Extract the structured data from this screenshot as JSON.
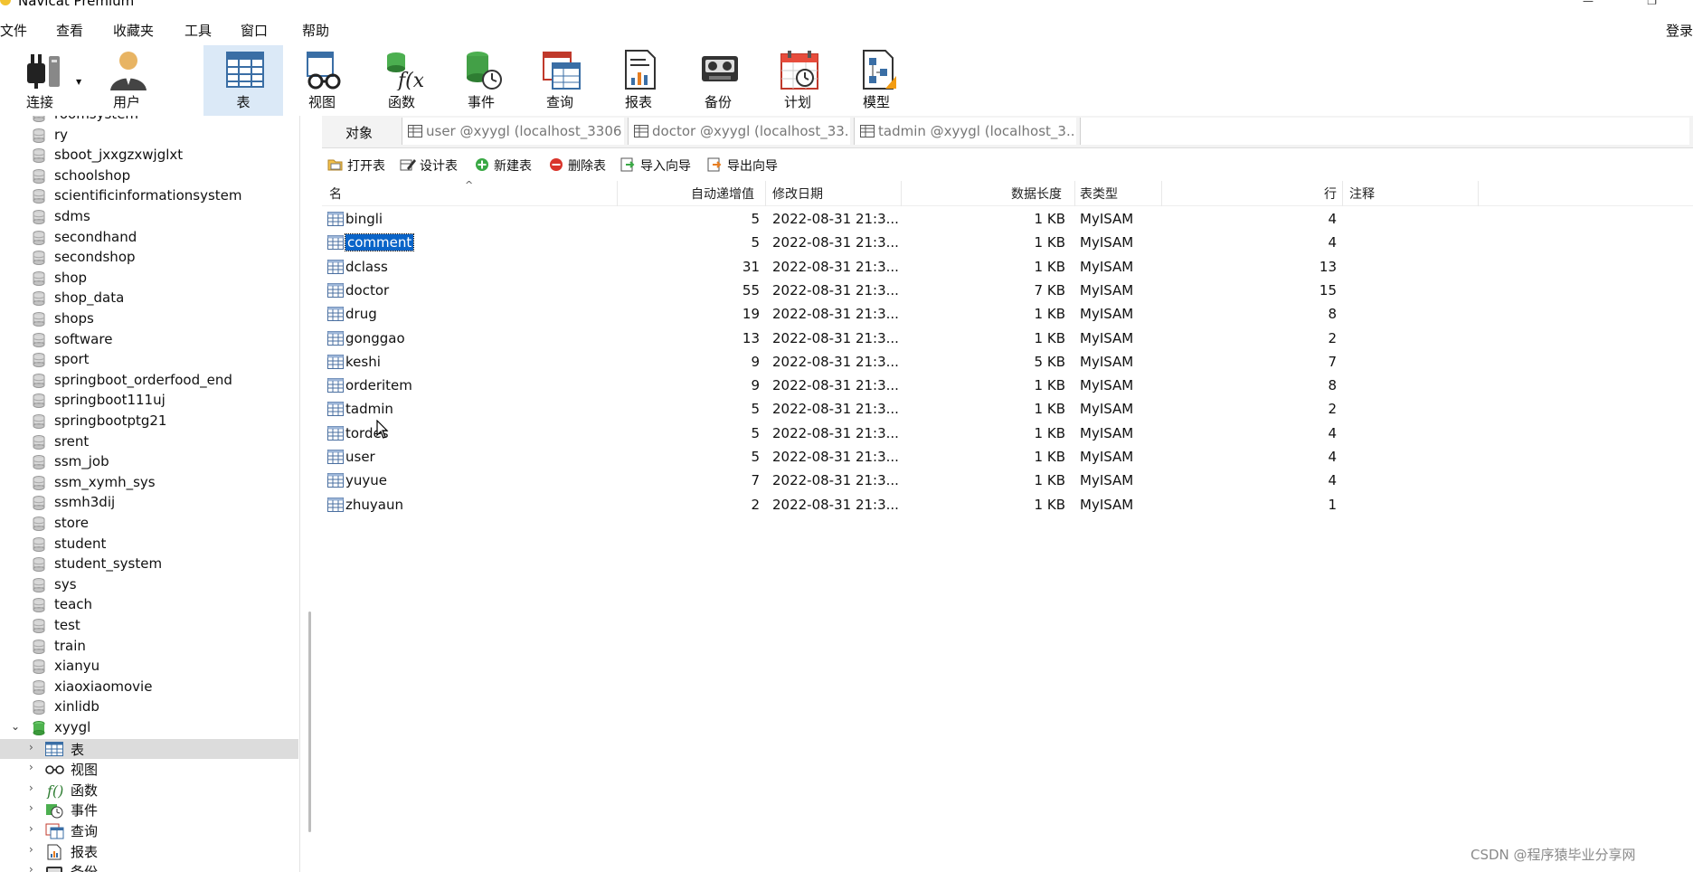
{
  "window": {
    "title": "Navicat Premium"
  },
  "menu": {
    "items": [
      "文件",
      "查看",
      "收藏夹",
      "工具",
      "窗口",
      "帮助"
    ],
    "login": "登录"
  },
  "toolbar": {
    "items": [
      {
        "label": "连接",
        "icon": "plug-icon"
      },
      {
        "label": "用户",
        "icon": "user-icon"
      },
      {
        "label": "表",
        "icon": "table-icon"
      },
      {
        "label": "视图",
        "icon": "view-icon"
      },
      {
        "label": "函数",
        "icon": "function-icon"
      },
      {
        "label": "事件",
        "icon": "event-icon"
      },
      {
        "label": "查询",
        "icon": "query-icon"
      },
      {
        "label": "报表",
        "icon": "report-icon"
      },
      {
        "label": "备份",
        "icon": "backup-icon"
      },
      {
        "label": "计划",
        "icon": "schedule-icon"
      },
      {
        "label": "模型",
        "icon": "model-icon"
      }
    ]
  },
  "sidebar": {
    "databases": [
      "roomsystem",
      "ry",
      "sboot_jxxgzxwjglxt",
      "schoolshop",
      "scientificinformationsystem",
      "sdms",
      "secondhand",
      "secondshop",
      "shop",
      "shop_data",
      "shops",
      "software",
      "sport",
      "springboot_orderfood_end",
      "springboot111uj",
      "springbootptg21",
      "srent",
      "ssm_job",
      "ssm_xymh_sys",
      "ssmh3dij",
      "store",
      "student",
      "student_system",
      "sys",
      "teach",
      "test",
      "train",
      "xianyu",
      "xiaoxiaomovie",
      "xinlidb"
    ],
    "open_db": "xyygl",
    "children": [
      {
        "label": "表",
        "icon": "table-icon"
      },
      {
        "label": "视图",
        "icon": "view-icon"
      },
      {
        "label": "函数",
        "icon": "function-icon"
      },
      {
        "label": "事件",
        "icon": "event-icon"
      },
      {
        "label": "查询",
        "icon": "query-icon"
      },
      {
        "label": "报表",
        "icon": "report-icon"
      },
      {
        "label": "备份",
        "icon": "backup-icon"
      }
    ]
  },
  "object_tabs": {
    "label": "对象",
    "tabs": [
      "user @xyygl (localhost_3306...",
      "doctor @xyygl (localhost_33...",
      "tadmin @xyygl (localhost_3..."
    ]
  },
  "actions": [
    "打开表",
    "设计表",
    "新建表",
    "删除表",
    "导入向导",
    "导出向导"
  ],
  "table": {
    "columns": [
      "名",
      "自动递增值",
      "修改日期",
      "数据长度",
      "表类型",
      "行",
      "注释"
    ],
    "selected": "comment",
    "rows": [
      {
        "name": "bingli",
        "auto_inc": "5",
        "modified": "2022-08-31 21:3...",
        "data_len": "1 KB",
        "engine": "MyISAM",
        "rows": "4"
      },
      {
        "name": "comment",
        "auto_inc": "5",
        "modified": "2022-08-31 21:3...",
        "data_len": "1 KB",
        "engine": "MyISAM",
        "rows": "4"
      },
      {
        "name": "dclass",
        "auto_inc": "31",
        "modified": "2022-08-31 21:3...",
        "data_len": "1 KB",
        "engine": "MyISAM",
        "rows": "13"
      },
      {
        "name": "doctor",
        "auto_inc": "55",
        "modified": "2022-08-31 21:3...",
        "data_len": "7 KB",
        "engine": "MyISAM",
        "rows": "15"
      },
      {
        "name": "drug",
        "auto_inc": "19",
        "modified": "2022-08-31 21:3...",
        "data_len": "1 KB",
        "engine": "MyISAM",
        "rows": "8"
      },
      {
        "name": "gonggao",
        "auto_inc": "13",
        "modified": "2022-08-31 21:3...",
        "data_len": "1 KB",
        "engine": "MyISAM",
        "rows": "2"
      },
      {
        "name": "keshi",
        "auto_inc": "9",
        "modified": "2022-08-31 21:3...",
        "data_len": "5 KB",
        "engine": "MyISAM",
        "rows": "7"
      },
      {
        "name": "orderitem",
        "auto_inc": "9",
        "modified": "2022-08-31 21:3...",
        "data_len": "1 KB",
        "engine": "MyISAM",
        "rows": "8"
      },
      {
        "name": "tadmin",
        "auto_inc": "5",
        "modified": "2022-08-31 21:3...",
        "data_len": "1 KB",
        "engine": "MyISAM",
        "rows": "2"
      },
      {
        "name": "tordes",
        "auto_inc": "5",
        "modified": "2022-08-31 21:3...",
        "data_len": "1 KB",
        "engine": "MyISAM",
        "rows": "4"
      },
      {
        "name": "user",
        "auto_inc": "5",
        "modified": "2022-08-31 21:3...",
        "data_len": "1 KB",
        "engine": "MyISAM",
        "rows": "4"
      },
      {
        "name": "yuyue",
        "auto_inc": "7",
        "modified": "2022-08-31 21:3...",
        "data_len": "1 KB",
        "engine": "MyISAM",
        "rows": "4"
      },
      {
        "name": "zhuyaun",
        "auto_inc": "2",
        "modified": "2022-08-31 21:3...",
        "data_len": "1 KB",
        "engine": "MyISAM",
        "rows": "1"
      }
    ]
  },
  "watermark": "CSDN @程序猿毕业分享网",
  "colors": {
    "selection": "#0a64c8",
    "toolbar_active": "#dbe9f7",
    "tree_selected": "#dcdcdc"
  }
}
